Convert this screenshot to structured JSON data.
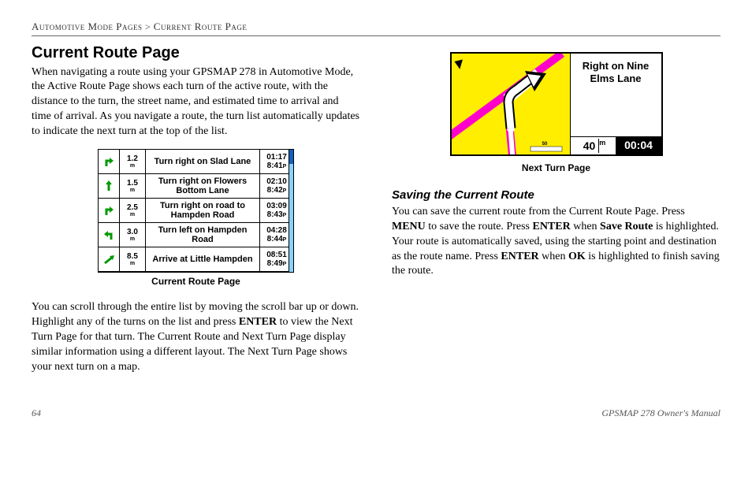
{
  "breadcrumb": {
    "path1": "Automotive Mode Pages",
    "sep": " > ",
    "path2": "Current Route Page"
  },
  "h1": "Current Route Page",
  "p1": "When navigating a route using your GPSMAP 278 in Automotive Mode, the Active Route Page shows each turn of the active route, with the distance to the turn, the street name, and estimated time to arrival and time of arrival. As you navigate a route, the turn list automatically updates to indicate the next turn at the top of the list.",
  "routeTable": [
    {
      "dist": "1.2",
      "unit": "m",
      "desc": "Turn right on Slad Lane",
      "t1": "01:17",
      "t2": "8:41",
      "ampm": "P",
      "dir": "right-up"
    },
    {
      "dist": "1.5",
      "unit": "m",
      "desc": "Turn right on Flowers Bottom Lane",
      "t1": "02:10",
      "t2": "8:42",
      "ampm": "P",
      "dir": "up"
    },
    {
      "dist": "2.5",
      "unit": "m",
      "desc": "Turn right on road to Hampden Road",
      "t1": "03:09",
      "t2": "8:43",
      "ampm": "P",
      "dir": "right-up"
    },
    {
      "dist": "3.0",
      "unit": "m",
      "desc": "Turn left on Hampden Road",
      "t1": "04:28",
      "t2": "8:44",
      "ampm": "P",
      "dir": "left-up"
    },
    {
      "dist": "8.5",
      "unit": "m",
      "desc": "Arrive at Little Hampden",
      "t1": "08:51",
      "t2": "8:49",
      "ampm": "P",
      "dir": "arrive"
    }
  ],
  "caption1": "Current Route Page",
  "p2a": "You can scroll through the entire list by moving the scroll bar up or down. Highlight any of the turns on the list and press ",
  "p2enter": "ENTER",
  "p2b": " to view the Next Turn Page for that turn. The Current Route and Next Turn Page display similar information using a different layout. The Next Turn Page shows your next turn on a map.",
  "nextTurn": {
    "text": "Right on Nine Elms Lane",
    "dist": "40",
    "distUnit": "m",
    "time": "00:04"
  },
  "caption2": "Next Turn Page",
  "h2": "Saving the Current Route",
  "p3a": "You can save the current route from the Current Route Page. Press ",
  "p3menu": "MENU",
  "p3b": " to save the route. Press ",
  "p3enter1": "ENTER",
  "p3c": " when ",
  "p3save": "Save Route",
  "p3d": " is highlighted. Your route is automatically saved, using the starting point and destination as the route name. Press ",
  "p3enter2": "ENTER",
  "p3e": " when ",
  "p3ok": "OK",
  "p3f": " is highlighted to finish saving the route.",
  "footer": {
    "page": "64",
    "manual": "GPSMAP 278 Owner's Manual"
  },
  "arrowColor": "#009900"
}
